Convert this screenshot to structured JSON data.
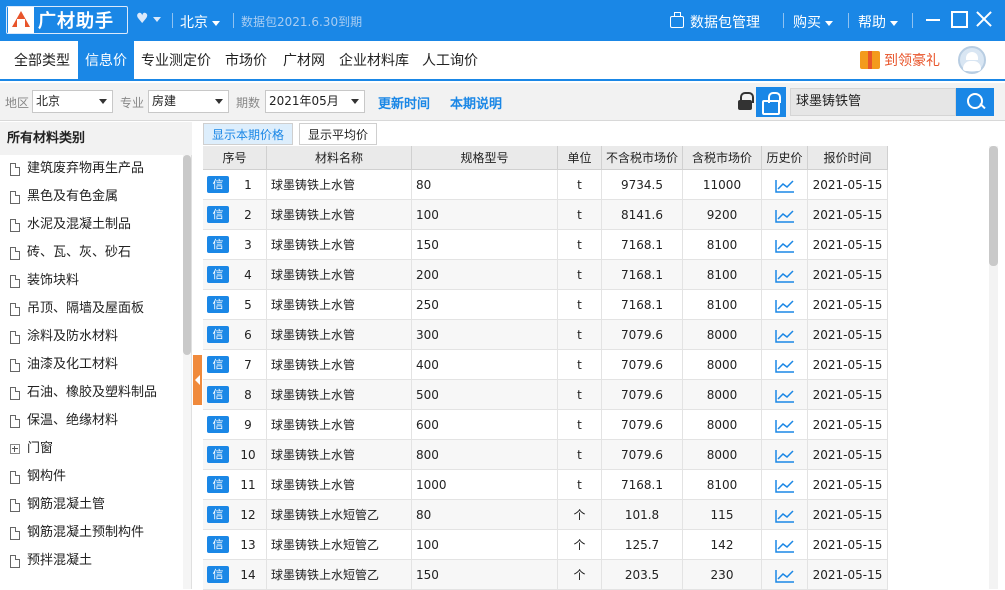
{
  "app": {
    "logo_text": "广材助手",
    "city": "北京",
    "expiry": "数据包2021.6.30到期",
    "package_mgmt": "数据包管理",
    "buy": "购买",
    "help": "帮助"
  },
  "nav": {
    "items": [
      "全部类型",
      "信息价",
      "专业测定价",
      "市场价",
      "广材网",
      "企业材料库",
      "人工询价"
    ],
    "active_index": 1,
    "gift_label": "到领豪礼"
  },
  "filters": {
    "region_label": "地区",
    "region_value": "北京",
    "major_label": "专业",
    "major_value": "房建",
    "period_label": "期数",
    "period_value": "2021年05月",
    "update_time": "更新时间",
    "period_note": "本期说明",
    "search_value": "球墨铸铁管"
  },
  "sidebar": {
    "title": "所有材料类别",
    "items": [
      {
        "label": "建筑废弃物再生产品",
        "icon": "doc-icon"
      },
      {
        "label": "黑色及有色金属",
        "icon": "doc-icon"
      },
      {
        "label": "水泥及混凝土制品",
        "icon": "doc-icon"
      },
      {
        "label": "砖、瓦、灰、砂石",
        "icon": "doc-icon"
      },
      {
        "label": "装饰块料",
        "icon": "doc-icon"
      },
      {
        "label": "吊顶、隔墙及屋面板",
        "icon": "doc-icon"
      },
      {
        "label": "涂料及防水材料",
        "icon": "doc-icon"
      },
      {
        "label": "油漆及化工材料",
        "icon": "doc-icon"
      },
      {
        "label": "石油、橡胶及塑料制品",
        "icon": "doc-icon"
      },
      {
        "label": "保温、绝缘材料",
        "icon": "doc-icon"
      },
      {
        "label": "门窗",
        "icon": "expand-icon"
      },
      {
        "label": "钢构件",
        "icon": "doc-icon"
      },
      {
        "label": "钢筋混凝土管",
        "icon": "doc-icon"
      },
      {
        "label": "钢筋混凝土预制构件",
        "icon": "doc-icon"
      },
      {
        "label": "预拌混凝土",
        "icon": "doc-icon"
      }
    ]
  },
  "tabs": [
    "显示本期价格",
    "显示平均价"
  ],
  "table": {
    "badge": "信",
    "headers": [
      "序号",
      "材料名称",
      "规格型号",
      "单位",
      "不含税市场价",
      "含税市场价",
      "历史价",
      "报价时间"
    ],
    "rows": [
      {
        "no": "1",
        "name": "球墨铸铁上水管",
        "spec": "80",
        "unit": "t",
        "ex_tax": "9734.5",
        "in_tax": "11000",
        "date": "2021-05-15"
      },
      {
        "no": "2",
        "name": "球墨铸铁上水管",
        "spec": "100",
        "unit": "t",
        "ex_tax": "8141.6",
        "in_tax": "9200",
        "date": "2021-05-15"
      },
      {
        "no": "3",
        "name": "球墨铸铁上水管",
        "spec": "150",
        "unit": "t",
        "ex_tax": "7168.1",
        "in_tax": "8100",
        "date": "2021-05-15"
      },
      {
        "no": "4",
        "name": "球墨铸铁上水管",
        "spec": "200",
        "unit": "t",
        "ex_tax": "7168.1",
        "in_tax": "8100",
        "date": "2021-05-15"
      },
      {
        "no": "5",
        "name": "球墨铸铁上水管",
        "spec": "250",
        "unit": "t",
        "ex_tax": "7168.1",
        "in_tax": "8100",
        "date": "2021-05-15"
      },
      {
        "no": "6",
        "name": "球墨铸铁上水管",
        "spec": "300",
        "unit": "t",
        "ex_tax": "7079.6",
        "in_tax": "8000",
        "date": "2021-05-15"
      },
      {
        "no": "7",
        "name": "球墨铸铁上水管",
        "spec": "400",
        "unit": "t",
        "ex_tax": "7079.6",
        "in_tax": "8000",
        "date": "2021-05-15"
      },
      {
        "no": "8",
        "name": "球墨铸铁上水管",
        "spec": "500",
        "unit": "t",
        "ex_tax": "7079.6",
        "in_tax": "8000",
        "date": "2021-05-15"
      },
      {
        "no": "9",
        "name": "球墨铸铁上水管",
        "spec": "600",
        "unit": "t",
        "ex_tax": "7079.6",
        "in_tax": "8000",
        "date": "2021-05-15"
      },
      {
        "no": "10",
        "name": "球墨铸铁上水管",
        "spec": "800",
        "unit": "t",
        "ex_tax": "7079.6",
        "in_tax": "8000",
        "date": "2021-05-15"
      },
      {
        "no": "11",
        "name": "球墨铸铁上水管",
        "spec": "1000",
        "unit": "t",
        "ex_tax": "7168.1",
        "in_tax": "8100",
        "date": "2021-05-15"
      },
      {
        "no": "12",
        "name": "球墨铸铁上水短管乙",
        "spec": "80",
        "unit": "个",
        "ex_tax": "101.8",
        "in_tax": "115",
        "date": "2021-05-15"
      },
      {
        "no": "13",
        "name": "球墨铸铁上水短管乙",
        "spec": "100",
        "unit": "个",
        "ex_tax": "125.7",
        "in_tax": "142",
        "date": "2021-05-15"
      },
      {
        "no": "14",
        "name": "球墨铸铁上水短管乙",
        "spec": "150",
        "unit": "个",
        "ex_tax": "203.5",
        "in_tax": "230",
        "date": "2021-05-15"
      }
    ]
  },
  "colors": {
    "brand": "#1a87e6",
    "accent_orange": "#f08a3c",
    "gift_red": "#e8542a"
  }
}
